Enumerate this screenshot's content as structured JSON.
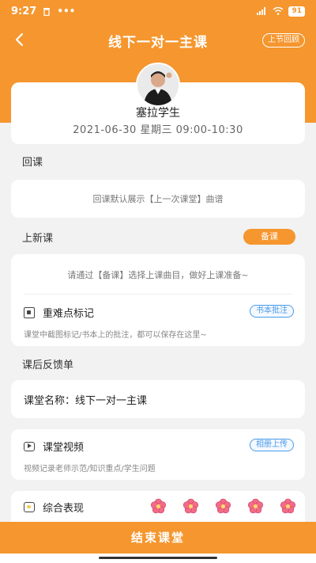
{
  "status": {
    "time": "9:27",
    "signal": "ମᵍl",
    "battery": "91"
  },
  "nav": {
    "title": "线下一对一主课",
    "prev_review": "上节回顾",
    "back": "‹"
  },
  "student": {
    "name": "塞拉学生",
    "time": "2021-06-30 星期三 09:00-10:30"
  },
  "review": {
    "title": "回课",
    "hint": "回课默认展示【上一次课堂】曲谱"
  },
  "new_lesson": {
    "title": "上新课",
    "prepare_button": "备课",
    "hint": "请通过【备课】选择上课曲目，做好上课准备~",
    "marks_title": "重难点标记",
    "marks_tag": "书本批注",
    "marks_desc": "课堂中截图标记/书本上的批注，都可以保存在这里~"
  },
  "feedback": {
    "title": "课后反馈单",
    "course_name": "课堂名称：线下一对一主课",
    "video_title": "课堂视频",
    "video_tag": "相册上传",
    "video_desc": "视频记录老师示范/知识重点/学生问题",
    "performance_title": "综合表现",
    "rating": 5,
    "rating_max": 5
  },
  "footer": {
    "end_button": "结束课堂"
  },
  "colors": {
    "accent": "#f5962e",
    "tag_blue": "#4a9be8",
    "flower": "#f36b86"
  },
  "icons": [
    "back-icon",
    "trash-icon",
    "more-icon",
    "signal-icon",
    "wifi-icon",
    "battery-icon",
    "marks-icon",
    "video-icon",
    "performance-icon",
    "flower-icon"
  ]
}
